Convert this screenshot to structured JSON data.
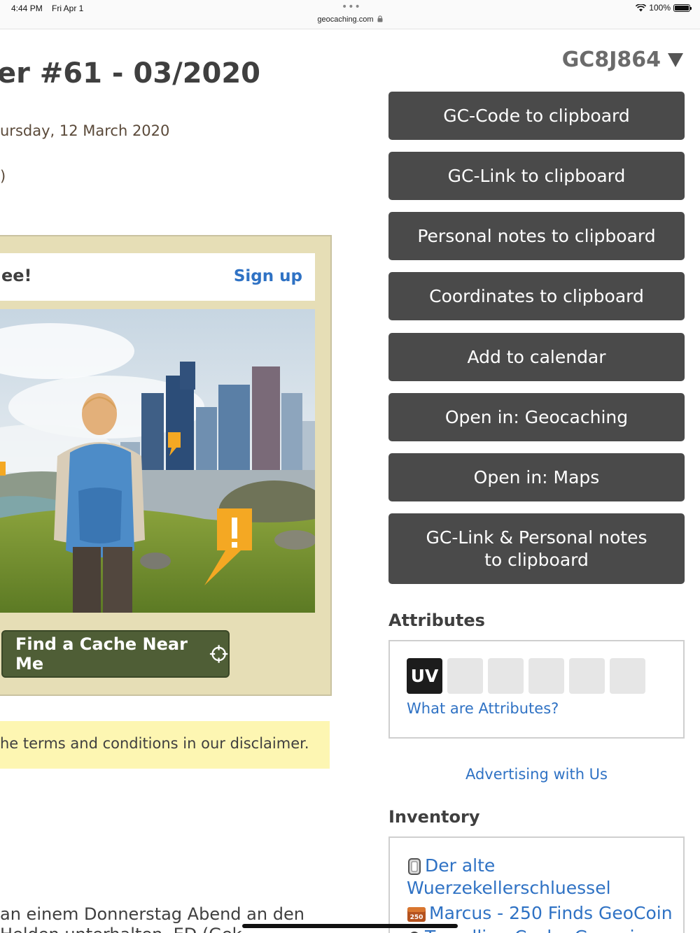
{
  "status": {
    "time": "4:44 PM",
    "date": "Fri Apr 1",
    "url": "geocaching.com",
    "battery": "100%",
    "dots": "•••"
  },
  "cache": {
    "title": "er #61 - 03/2020",
    "date_line": "ursday, 12 March 2020",
    "paren": ")",
    "code": "GC8J864"
  },
  "promo": {
    "free_text": "ee!",
    "signup": "Sign up",
    "find_button": "Find a Cache Near Me"
  },
  "disclaimer": "he terms and conditions in our disclaimer.",
  "body": {
    "line1": "an einem Donnerstag Abend an den",
    "line2": "Helden unterhalten. ED (Gek"
  },
  "actions": [
    "GC-Code to clipboard",
    "GC-Link to clipboard",
    "Personal notes to clipboard",
    "Coordinates to clipboard",
    "Add to calendar",
    "Open in: Geocaching",
    "Open in: Maps",
    "GC-Link & Personal notes to clipboard"
  ],
  "attributes": {
    "heading": "Attributes",
    "uv_label": "UV",
    "link": "What are Attributes?"
  },
  "advertising": "Advertising with Us",
  "inventory": {
    "heading": "Inventory",
    "items": [
      "Der alte Wuerzekellerschluessel",
      "Marcus - 250 Finds GeoCoin",
      "Travelling Cache Geocoin"
    ],
    "coin_badge": "250"
  },
  "colors": {
    "button_bg": "#4a4a4a",
    "link": "#2f72c4",
    "promo_bg": "#e6deb6",
    "find_btn": "#4f5e36",
    "disclaimer_bg": "#fdf6b2"
  }
}
